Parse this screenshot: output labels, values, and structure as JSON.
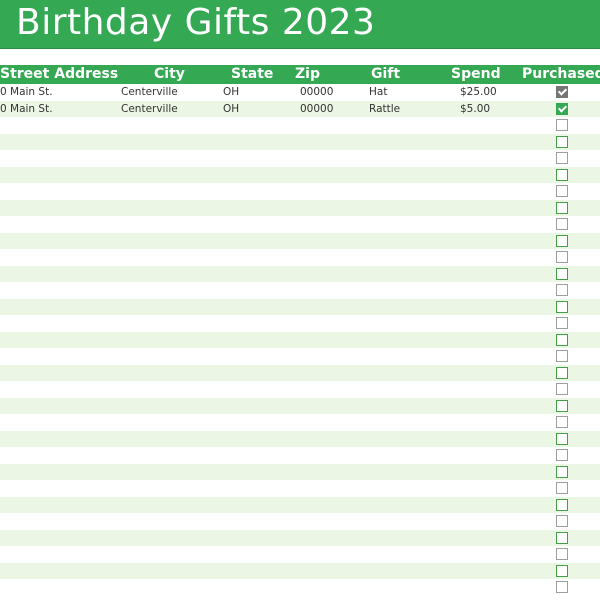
{
  "title": "Birthday Gifts 2023",
  "columns": {
    "street": "Street Address",
    "city": "City",
    "state": "State",
    "zip": "Zip",
    "gift": "Gift",
    "spend": "Spend",
    "purchased": "Purchased"
  },
  "rows": [
    {
      "street": "0 Main St.",
      "city": "Centerville",
      "state": "OH",
      "zip": "00000",
      "gift": "Hat",
      "spend": "$25.00",
      "purchased": true
    },
    {
      "street": "0 Main St.",
      "city": "Centerville",
      "state": "OH",
      "zip": "00000",
      "gift": "Rattle",
      "spend": "$5.00",
      "purchased": true
    }
  ],
  "empty_row_count": 29,
  "colors": {
    "accent": "#34a853",
    "band": "#ecf6e4"
  }
}
